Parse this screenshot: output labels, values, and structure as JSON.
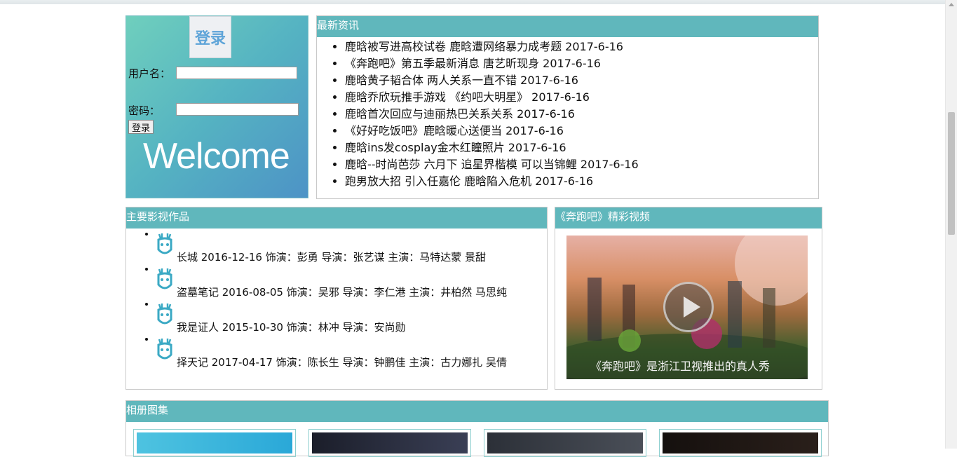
{
  "login": {
    "logo_text": "登录",
    "username_label": "用户名：",
    "username_value": "",
    "password_label": "密码：",
    "password_value": "",
    "submit_label": "登录",
    "welcome_text": "Welcome"
  },
  "news": {
    "title": "最新资讯",
    "items": [
      "鹿晗被写进高校试卷 鹿晗遭网络暴力成考题   2017-6-16",
      "《奔跑吧》第五季最新消息 唐艺昕现身  2017-6-16",
      "鹿晗黄子韬合体 两人关系一直不错  2017-6-16",
      "鹿晗乔欣玩推手游戏 《约吧大明星》  2017-6-16",
      "鹿晗首次回应与迪丽热巴关系关系  2017-6-16",
      "《好好吃饭吧》鹿晗暖心送便当  2017-6-16",
      "鹿晗ins发cosplay金木红瞳照片  2017-6-16",
      "鹿晗--时尚芭莎 六月下 追星界楷模 可以当锦鲤  2017-6-16",
      "跑男放大招 引入任嘉伦 鹿晗陷入危机  2017-6-16"
    ]
  },
  "works": {
    "title": "主要影视作品",
    "items": [
      "长城 2016-12-16 饰演：彭勇 导演：张艺谋 主演：马特达蒙 景甜",
      "盗墓笔记 2016-08-05 饰演：吴邪 导演：李仁港 主演：井柏然 马思纯",
      "我是证人 2015-10-30 饰演：林冲 导演：安尚勋",
      "择天记 2017-04-17 饰演：陈长生 导演：钟鹏佳 主演：古力娜扎 吴倩"
    ]
  },
  "video": {
    "title": "《奔跑吧》精彩视频",
    "caption": "《奔跑吧》是浙江卫视推出的真人秀"
  },
  "album": {
    "title": "相册图集"
  },
  "colors": {
    "header_teal": "#60b7bc",
    "login_gradient_start": "#6fcfbd",
    "login_gradient_end": "#4d93c6"
  }
}
